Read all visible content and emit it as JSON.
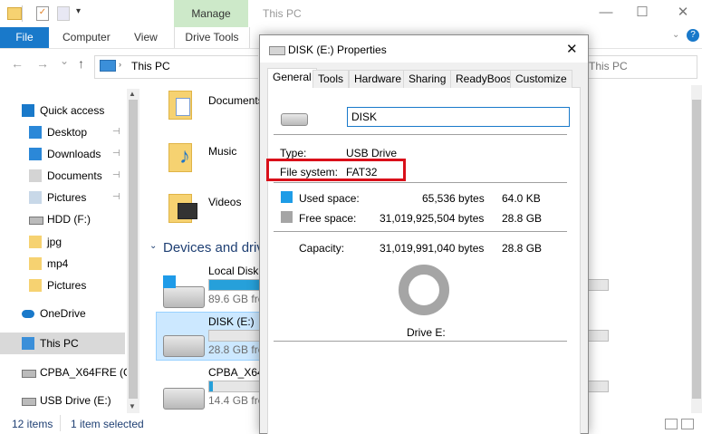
{
  "titlebar": {
    "manage_label": "Manage",
    "title": "This PC",
    "minimize": "—",
    "maximize": "☐",
    "close": "✕"
  },
  "ribbon": {
    "file_label": "File",
    "computer_label": "Computer",
    "view_label": "View",
    "drive_tools_label": "Drive Tools"
  },
  "nav": {
    "back": "←",
    "forward": "→",
    "down": "⌄",
    "up": "↑",
    "address": "This PC",
    "address_right": "This PC"
  },
  "sidebar": {
    "items": [
      {
        "label": "Quick access",
        "icon": "star-icon",
        "pinned": false
      },
      {
        "label": "Desktop",
        "icon": "desktop-icon",
        "pinned": true
      },
      {
        "label": "Downloads",
        "icon": "download-icon",
        "pinned": true
      },
      {
        "label": "Documents",
        "icon": "documents-icon",
        "pinned": true
      },
      {
        "label": "Pictures",
        "icon": "pictures-icon",
        "pinned": true
      },
      {
        "label": "HDD (F:)",
        "icon": "drive-icon",
        "pinned": false
      },
      {
        "label": "jpg",
        "icon": "folder-icon",
        "pinned": false
      },
      {
        "label": "mp4",
        "icon": "folder-icon",
        "pinned": false
      },
      {
        "label": "Pictures",
        "icon": "folder-icon",
        "pinned": false
      },
      {
        "label": "OneDrive",
        "icon": "cloud-icon",
        "pinned": false
      },
      {
        "label": "This PC",
        "icon": "computer-icon",
        "pinned": false
      },
      {
        "label": "CPBA_X64FRE (G:)",
        "icon": "drive-icon",
        "pinned": false
      },
      {
        "label": "USB Drive (E:)",
        "icon": "usb-drive-icon",
        "pinned": false
      }
    ],
    "pin_glyph": "📌"
  },
  "content": {
    "folders": [
      {
        "label": "Documents"
      },
      {
        "label": "Music"
      },
      {
        "label": "Videos"
      }
    ],
    "section_header": "Devices and drives",
    "drives": [
      {
        "name": "Local Disk",
        "free": "89.6 GB free",
        "used_fraction": 0.78
      },
      {
        "name": "DISK (E:)",
        "free": "28.8 GB free",
        "used_fraction": 0.0
      },
      {
        "name": "CPBA_X64FRE",
        "free": "14.4 GB free",
        "used_fraction": 0.01
      }
    ]
  },
  "status": {
    "items": "12 items",
    "selected": "1 item selected"
  },
  "dialog": {
    "title": "DISK (E:) Properties",
    "close": "✕",
    "tabs": [
      "General",
      "Tools",
      "Hardware",
      "Sharing",
      "ReadyBoost",
      "Customize"
    ],
    "name_value": "DISK",
    "type_label": "Type:",
    "type_value": "USB Drive",
    "fs_label": "File system:",
    "fs_value": "FAT32",
    "used_label": "Used space:",
    "used_bytes": "65,536 bytes",
    "used_size": "64.0 KB",
    "free_label": "Free space:",
    "free_bytes": "31,019,925,504 bytes",
    "free_size": "28.8 GB",
    "capacity_label": "Capacity:",
    "capacity_bytes": "31,019,991,040 bytes",
    "capacity_size": "28.8 GB",
    "drive_label": "Drive E:",
    "used_color": "#1e9ce6",
    "free_color": "#a5a5a5",
    "highlight_color": "#d9101a"
  }
}
